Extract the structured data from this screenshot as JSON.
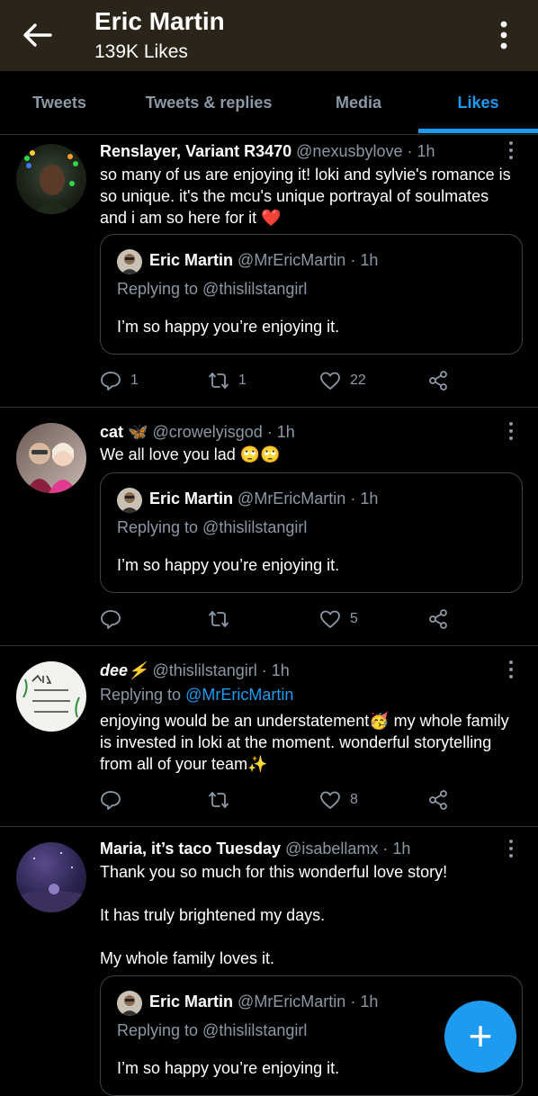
{
  "header": {
    "title": "Eric Martin",
    "subtitle": "139K Likes"
  },
  "tabs": [
    "Tweets",
    "Tweets & replies",
    "Media",
    "Likes"
  ],
  "active_tab": "Likes",
  "colors": {
    "accent": "#1d9bf0",
    "header_bg": "#2a2419",
    "bg": "#000000",
    "muted": "#8b98a5"
  },
  "tweets": [
    {
      "name": "Renslayer, Variant R3470",
      "handle": "@nexusbylove",
      "time": "· 1h",
      "lines": [
        "so many of us are enjoying it! loki and sylvie's romance is",
        "so unique. it's the mcu's unique portrayal of soulmates",
        "and i am so here for it ❤️"
      ],
      "quote": {
        "name": "Eric Martin",
        "handle": "@MrEricMartin",
        "time": "· 1h",
        "replying": "Replying to @thislilstangirl",
        "text": "I’m so happy you’re enjoying it."
      },
      "replies": "1",
      "retweets": "1",
      "likes": "22"
    },
    {
      "name": "cat 🦋",
      "handle": "@crowelyisgod",
      "time": "· 1h",
      "lines": [
        "We all love you lad 🙄🙄"
      ],
      "quote": {
        "name": "Eric Martin",
        "handle": "@MrEricMartin",
        "time": "· 1h",
        "replying": "Replying to @thislilstangirl",
        "text": "I’m so happy you’re enjoying it."
      },
      "replies": "",
      "retweets": "",
      "likes": "5"
    },
    {
      "name": "dee⚡",
      "handle": "@thislilstangirl",
      "time": "· 1h",
      "replying_prefix": "Replying to",
      "replying_mention": "@MrEricMartin",
      "lines": [
        "enjoying would be an understatement🥳 my whole family",
        "is invested in loki at the moment. wonderful storytelling",
        "from all of your team✨"
      ],
      "replies": "",
      "retweets": "",
      "likes": "8"
    },
    {
      "name": "Maria, it’s taco Tuesday",
      "handle": "@isabellamx",
      "time": "· 1h",
      "lines": [
        "Thank you so much for this wonderful love story!",
        "",
        "It has truly brightened my days.",
        "",
        "My whole family loves it."
      ],
      "quote": {
        "name": "Eric Martin",
        "handle": "@MrEricMartin",
        "time": "· 1h",
        "replying": "Replying to @thislilstangirl",
        "text": "I’m so happy you’re enjoying it."
      }
    }
  ],
  "fab_label": "+"
}
